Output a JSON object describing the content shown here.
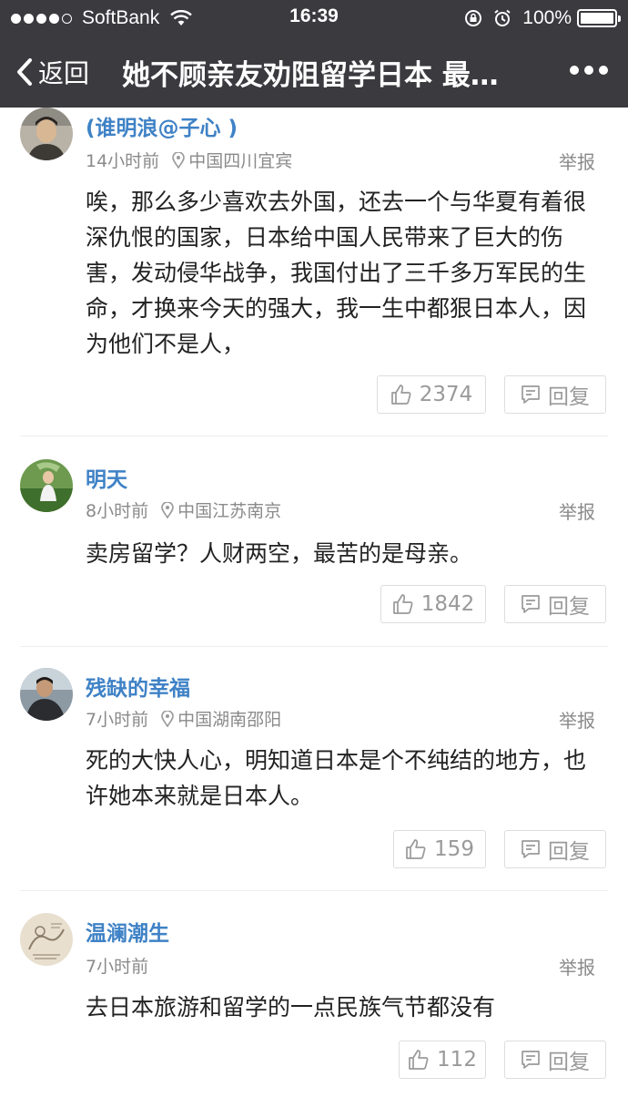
{
  "status_bar": {
    "carrier": "SoftBank",
    "time": "16:39",
    "battery": "100%"
  },
  "nav": {
    "back_label": "返回",
    "title": "她不顾亲友劝阻留学日本 最…"
  },
  "comments": [
    {
      "user": "(谁明浪@子心 )",
      "time_ago": "14小时前",
      "location": "中国四川宜宾",
      "report": "举报",
      "text": "唉，那么多少喜欢去外国，还去一个与华夏有着很深仇恨的国家，日本给中国人民带来了巨大的伤害，发动侵华战争，我国付出了三千多万军民的生命，才换来今天的强大，我一生中都狠日本人，因为他们不是人，",
      "likes": "2374",
      "reply": "回复"
    },
    {
      "user": "明天",
      "time_ago": "8小时前",
      "location": "中国江苏南京",
      "report": "举报",
      "text": "卖房留学？人财两空，最苦的是母亲。",
      "likes": "1842",
      "reply": "回复"
    },
    {
      "user": "残缺的幸福",
      "time_ago": "7小时前",
      "location": "中国湖南邵阳",
      "report": "举报",
      "text": "死的大快人心，明知道日本是个不纯结的地方，也许她本来就是日本人。",
      "likes": "159",
      "reply": "回复"
    },
    {
      "user": "温澜潮生",
      "time_ago": "7小时前",
      "location": "",
      "report": "举报",
      "text": "去日本旅游和留学的一点民族气节都没有",
      "likes": "112",
      "reply": "回复"
    }
  ]
}
